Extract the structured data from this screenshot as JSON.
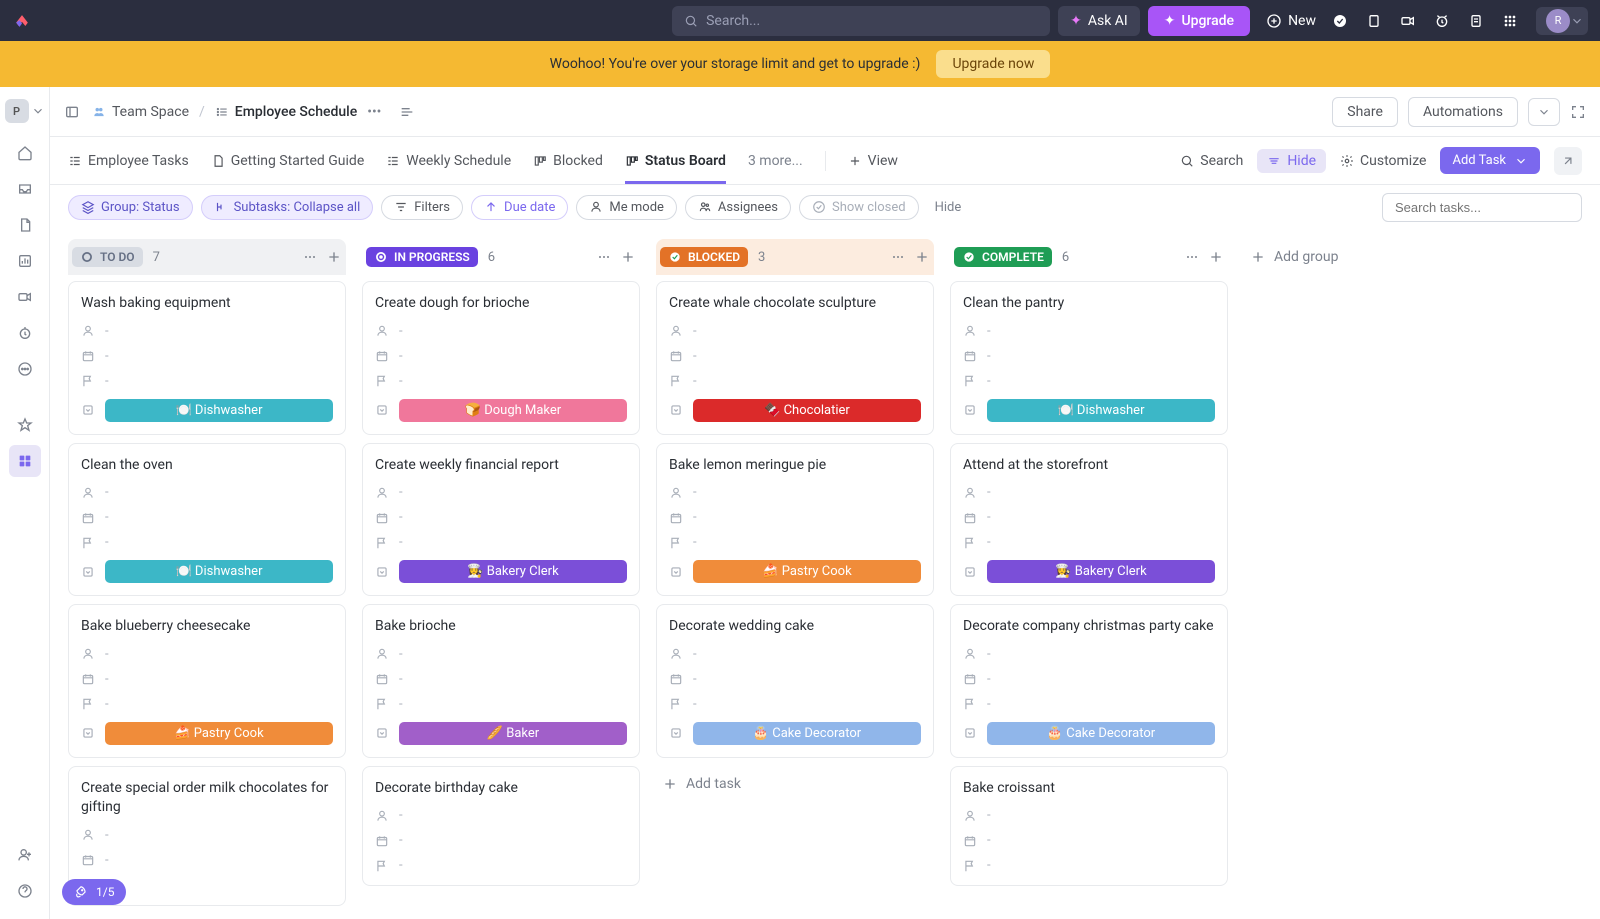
{
  "topbar": {
    "search_placeholder": "Search...",
    "ask_ai": "Ask AI",
    "upgrade": "Upgrade",
    "new": "New",
    "avatar_letter": "R"
  },
  "banner": {
    "message": "Woohoo! You're over your storage limit and get to upgrade :)",
    "button": "Upgrade now"
  },
  "workspace_letter": "P",
  "breadcrumb": {
    "space": "Team Space",
    "page": "Employee Schedule"
  },
  "header": {
    "share": "Share",
    "automations": "Automations"
  },
  "views": {
    "tabs": [
      "Employee Tasks",
      "Getting Started Guide",
      "Weekly Schedule",
      "Blocked",
      "Status Board"
    ],
    "more": "3 more...",
    "view": "View",
    "search": "Search",
    "hide": "Hide",
    "customize": "Customize",
    "add_task": "Add Task"
  },
  "filters": {
    "group": "Group: Status",
    "subtasks": "Subtasks: Collapse all",
    "filters": "Filters",
    "due": "Due date",
    "me": "Me mode",
    "assignees": "Assignees",
    "closed": "Show closed",
    "hide": "Hide",
    "search_placeholder": "Search tasks..."
  },
  "columns": [
    {
      "key": "todo",
      "label": "TO DO",
      "count": "7",
      "cards": [
        {
          "title": "Wash baking equipment",
          "tag": "🍽️ Dishwasher",
          "tag_bg": "#3cb7c7"
        },
        {
          "title": "Clean the oven",
          "tag": "🍽️ Dishwasher",
          "tag_bg": "#3cb7c7"
        },
        {
          "title": "Bake blueberry cheesecake",
          "tag": "🍰 Pastry Cook",
          "tag_bg": "#f08c3a"
        },
        {
          "title": "Create special order milk chocolates for gifting",
          "tag": "",
          "tag_bg": ""
        }
      ]
    },
    {
      "key": "progress",
      "label": "IN PROGRESS",
      "count": "6",
      "cards": [
        {
          "title": "Create dough for brioche",
          "tag": "🍞 Dough Maker",
          "tag_bg": "#f0779b"
        },
        {
          "title": "Create weekly financial report",
          "tag": "👩‍🍳 Bakery Clerk",
          "tag_bg": "#7b4fd8"
        },
        {
          "title": "Bake brioche",
          "tag": "🥖 Baker",
          "tag_bg": "#a15fc9"
        },
        {
          "title": "Decorate birthday cake",
          "tag": "",
          "tag_bg": ""
        }
      ]
    },
    {
      "key": "blocked",
      "label": "BLOCKED",
      "count": "3",
      "cards": [
        {
          "title": "Create whale chocolate sculpture",
          "tag": "🍫 Chocolatier",
          "tag_bg": "#db2a2a"
        },
        {
          "title": "Bake lemon meringue pie",
          "tag": "🍰 Pastry Cook",
          "tag_bg": "#f08c3a"
        },
        {
          "title": "Decorate wedding cake",
          "tag": "🎂 Cake Decorator",
          "tag_bg": "#90b6ea"
        }
      ],
      "add_task": "Add task"
    },
    {
      "key": "complete",
      "label": "COMPLETE",
      "count": "6",
      "cards": [
        {
          "title": "Clean the pantry",
          "tag": "🍽️ Dishwasher",
          "tag_bg": "#3cb7c7"
        },
        {
          "title": "Attend at the storefront",
          "tag": "👩‍🍳 Bakery Clerk",
          "tag_bg": "#7b4fd8"
        },
        {
          "title": "Decorate company christmas party cake",
          "tag": "🎂 Cake Decorator",
          "tag_bg": "#90b6ea"
        },
        {
          "title": "Bake croissant",
          "tag": "",
          "tag_bg": ""
        }
      ]
    }
  ],
  "add_group": "Add group",
  "progress_fab": "1/5"
}
